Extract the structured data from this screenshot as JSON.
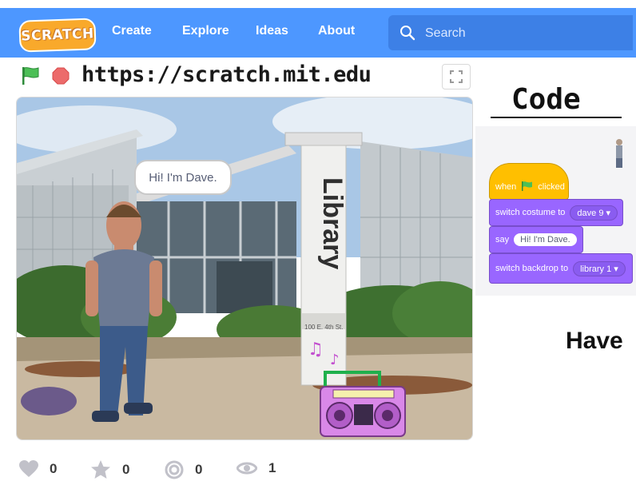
{
  "nav": {
    "logo_text": "SCRATCH",
    "links": [
      "Create",
      "Explore",
      "Ideas",
      "About"
    ],
    "search_placeholder": "Search",
    "bg_color": "#4d97ff"
  },
  "stage_header": {
    "url": "https://scratch.mit.edu"
  },
  "stage": {
    "speech_text": "Hi! I'm Dave.",
    "library_sign": "Library",
    "address": "100 E. 4th St."
  },
  "code": {
    "title": "Code",
    "blocks": {
      "hat_when": "when",
      "hat_clicked": "clicked",
      "switch_costume": "switch costume to",
      "costume_value": "dave 9",
      "say": "say",
      "say_value": "Hi! I'm Dave.",
      "switch_backdrop": "switch backdrop to",
      "backdrop_value": "library 1"
    },
    "overlay_text": "Have"
  },
  "stats": {
    "loves": "0",
    "favorites": "0",
    "remixes": "0",
    "views": "1"
  }
}
